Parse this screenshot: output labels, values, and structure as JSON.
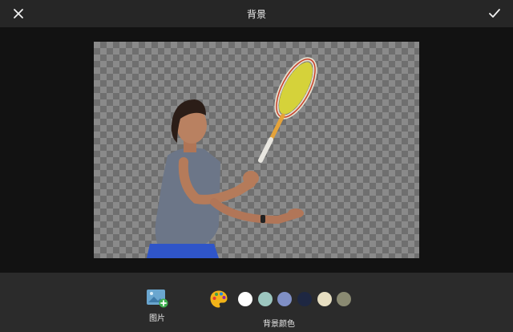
{
  "header": {
    "title": "背景"
  },
  "toolbar": {
    "image_label": "图片",
    "background_color_label": "背景颜色",
    "swatches": [
      "#ffffff",
      "#9cc6bf",
      "#7f8fc5",
      "#1e2742",
      "#e7dfc2",
      "#8a8a72"
    ]
  },
  "colors": {
    "header_bg": "#262626",
    "toolbar_bg": "#2b2b2b",
    "checker_dark": "#6f6f6f",
    "checker_light": "#8a8a8a"
  },
  "icons": {
    "close": "close-icon",
    "confirm": "checkmark-icon",
    "undo": "undo-icon",
    "redo": "redo-icon",
    "image": "image-add-icon",
    "palette": "palette-icon"
  }
}
